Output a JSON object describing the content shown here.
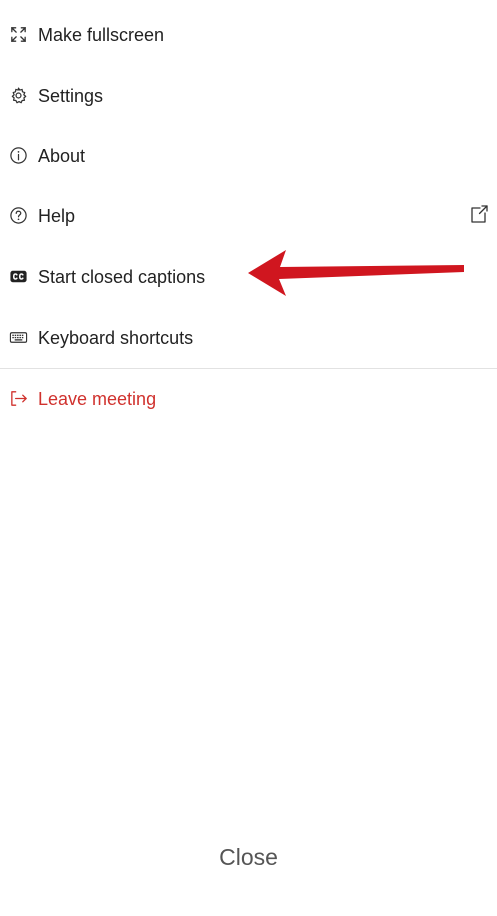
{
  "menu": {
    "items": [
      {
        "label": "Make fullscreen",
        "icon": "fullscreen-icon"
      },
      {
        "label": "Settings",
        "icon": "gear-icon"
      },
      {
        "label": "About",
        "icon": "info-icon"
      },
      {
        "label": "Help",
        "icon": "help-icon",
        "trailing_icon": "external-link-icon"
      },
      {
        "label": "Start closed captions",
        "icon": "closed-captions-icon"
      },
      {
        "label": "Keyboard shortcuts",
        "icon": "keyboard-icon"
      },
      {
        "label": "Leave meeting",
        "icon": "leave-icon"
      }
    ]
  },
  "footer": {
    "close_label": "Close"
  },
  "colors": {
    "text": "#222222",
    "danger": "#d0312d",
    "annotation_arrow": "#d0161f",
    "divider": "#e2e2e2",
    "close_text": "#555555"
  }
}
